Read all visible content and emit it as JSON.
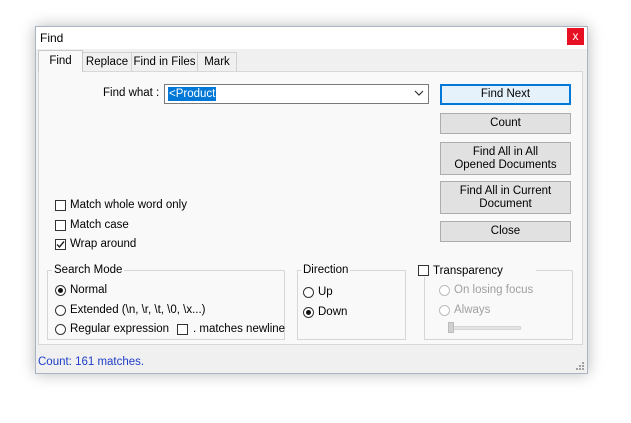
{
  "window": {
    "title": "Find",
    "close_glyph": "x"
  },
  "tabs": [
    {
      "label": "Find",
      "active": true
    },
    {
      "label": "Replace",
      "active": false
    },
    {
      "label": "Find in Files",
      "active": false
    },
    {
      "label": "Mark",
      "active": false
    }
  ],
  "find_what": {
    "label": "Find what :",
    "value": "<Product"
  },
  "buttons": {
    "find_next": "Find Next",
    "count": "Count",
    "find_all_opened": "Find All in All Opened Documents",
    "find_all_current": "Find All in Current Document",
    "close": "Close"
  },
  "options": {
    "match_whole_word": {
      "label": "Match whole word only",
      "checked": false
    },
    "match_case": {
      "label": "Match case",
      "checked": false
    },
    "wrap_around": {
      "label": "Wrap around",
      "checked": true
    }
  },
  "search_mode": {
    "title": "Search Mode",
    "normal": "Normal",
    "extended": "Extended (\\n, \\r, \\t, \\0, \\x...)",
    "regex": "Regular expression",
    "matches_newline": ". matches newline",
    "selected": "Normal"
  },
  "direction": {
    "title": "Direction",
    "up": "Up",
    "down": "Down",
    "selected": "Down"
  },
  "transparency": {
    "title": "Transparency",
    "checked": false,
    "on_losing_focus": "On losing focus",
    "always": "Always"
  },
  "status": {
    "text": "Count: 161 matches."
  },
  "colors": {
    "accent": "#0078d7",
    "close_red": "#e81123",
    "status_blue": "#1e3dc8"
  },
  "icons": [
    "close-icon",
    "chevron-down-icon",
    "checkmark-icon",
    "resize-grip-icon"
  ]
}
